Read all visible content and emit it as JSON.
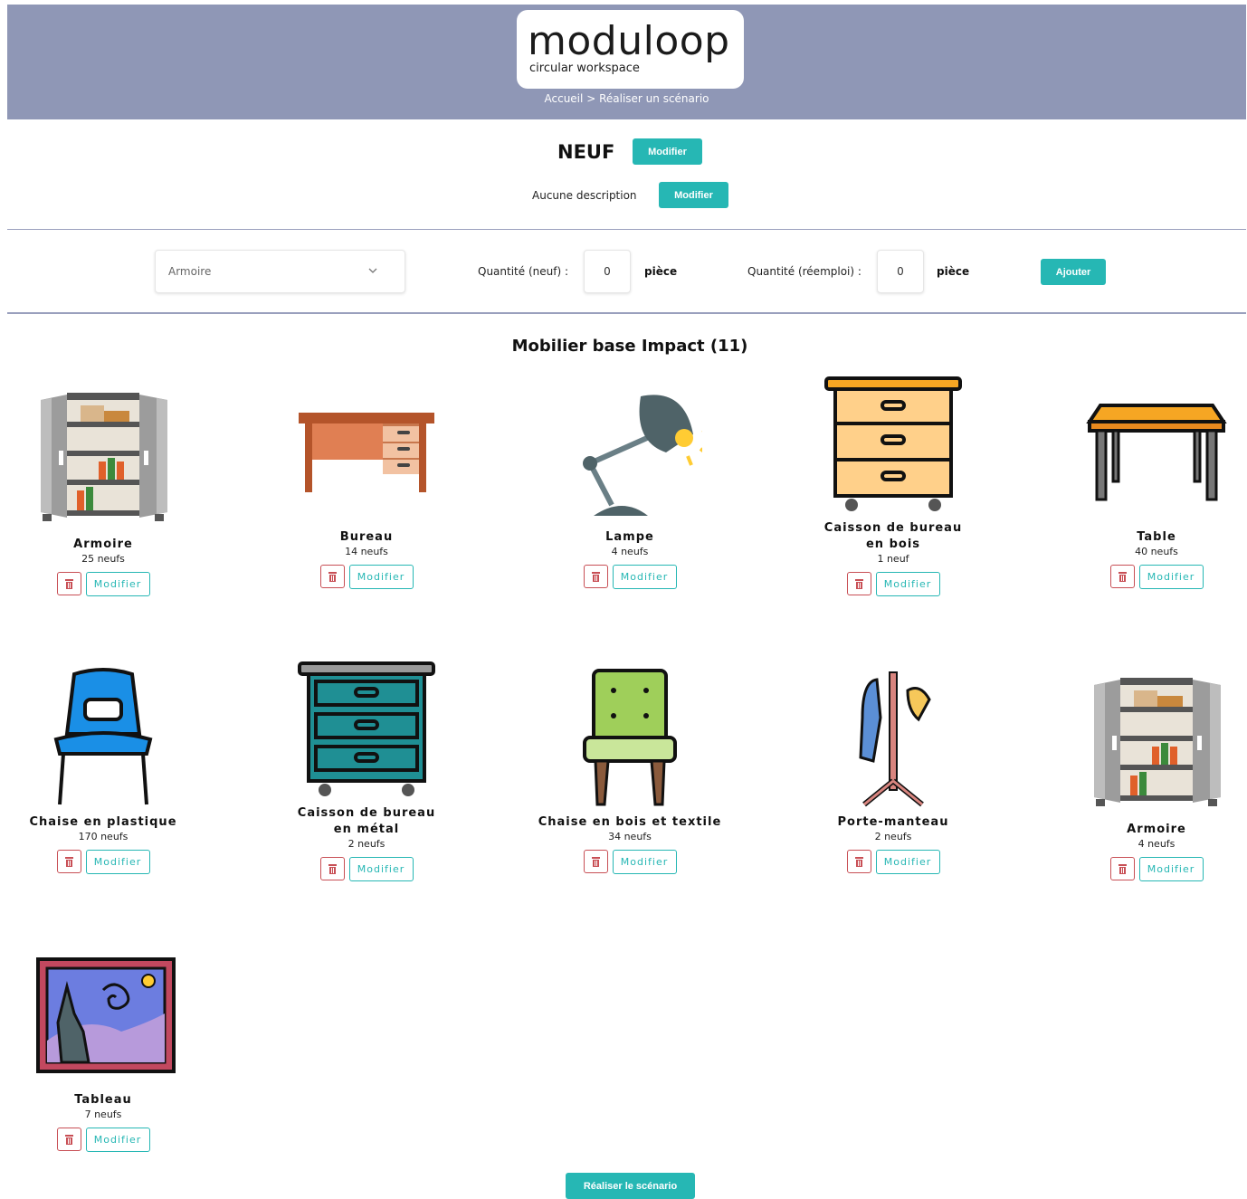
{
  "header": {
    "logo_word": "moduloop",
    "logo_tagline": "circular workspace",
    "breadcrumb_home": "Accueil",
    "breadcrumb_sep": ">",
    "breadcrumb_current": "Réaliser un scénario"
  },
  "scenario": {
    "title": "NEUF",
    "edit_title_label": "Modifier",
    "description": "Aucune description",
    "edit_desc_label": "Modifier"
  },
  "add_form": {
    "selected_item": "Armoire",
    "qty_new_label": "Quantité (neuf) :",
    "qty_new_value": "0",
    "qty_new_unit": "pièce",
    "qty_reuse_label": "Quantité (réemploi) :",
    "qty_reuse_value": "0",
    "qty_reuse_unit": "pièce",
    "add_label": "Ajouter"
  },
  "section_title": "Mobilier base Impact (11)",
  "items": [
    {
      "name": "Armoire",
      "count": "25 neufs",
      "icon": "wardrobe-icon",
      "edit_label": "Modifier"
    },
    {
      "name": "Bureau",
      "count": "14 neufs",
      "icon": "desk-icon",
      "edit_label": "Modifier"
    },
    {
      "name": "Lampe",
      "count": "4 neufs",
      "icon": "lamp-icon",
      "edit_label": "Modifier"
    },
    {
      "name": "Caisson de bureau en bois",
      "count": "1 neuf",
      "icon": "drawer-wood-icon",
      "edit_label": "Modifier"
    },
    {
      "name": "Table",
      "count": "40 neufs",
      "icon": "table-icon",
      "edit_label": "Modifier"
    },
    {
      "name": "Chaise en plastique",
      "count": "170 neufs",
      "icon": "plastic-chair-icon",
      "edit_label": "Modifier"
    },
    {
      "name": "Caisson de bureau en métal",
      "count": "2 neufs",
      "icon": "drawer-metal-icon",
      "edit_label": "Modifier"
    },
    {
      "name": "Chaise en bois et textile",
      "count": "34 neufs",
      "icon": "fabric-chair-icon",
      "edit_label": "Modifier"
    },
    {
      "name": "Porte-manteau",
      "count": "2 neufs",
      "icon": "coat-rack-icon",
      "edit_label": "Modifier"
    },
    {
      "name": "Armoire",
      "count": "4 neufs",
      "icon": "wardrobe-icon",
      "edit_label": "Modifier"
    },
    {
      "name": "Tableau",
      "count": "7 neufs",
      "icon": "painting-icon",
      "edit_label": "Modifier"
    }
  ],
  "footer": {
    "submit_label": "Réaliser le scénario"
  },
  "colors": {
    "header_bg": "#8f97b6",
    "accent": "#26b7b4",
    "danger": "#c84f55"
  }
}
